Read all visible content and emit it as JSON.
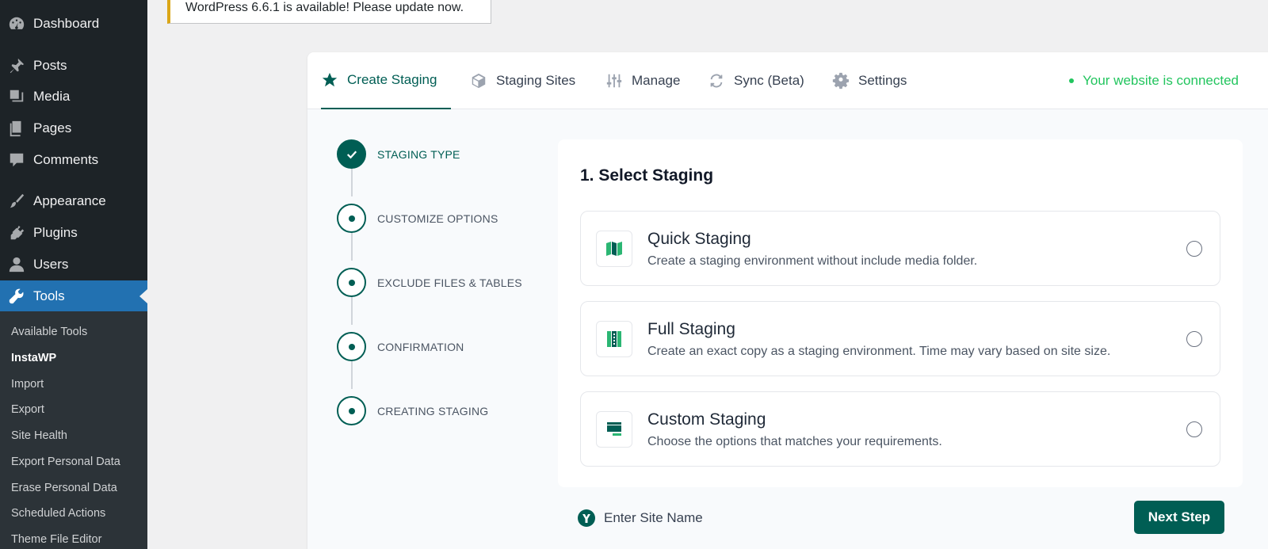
{
  "sidebar": {
    "items": [
      {
        "label": "Dashboard",
        "icon": "dashboard-icon"
      },
      {
        "label": "Posts",
        "icon": "pin-icon"
      },
      {
        "label": "Media",
        "icon": "media-icon"
      },
      {
        "label": "Pages",
        "icon": "pages-icon"
      },
      {
        "label": "Comments",
        "icon": "comment-icon"
      },
      {
        "label": "Appearance",
        "icon": "paintbrush-icon"
      },
      {
        "label": "Plugins",
        "icon": "plug-icon"
      },
      {
        "label": "Users",
        "icon": "user-icon"
      },
      {
        "label": "Tools",
        "icon": "wrench-icon",
        "active": true
      }
    ],
    "submenu": [
      "Available Tools",
      "InstaWP",
      "Import",
      "Export",
      "Site Health",
      "Export Personal Data",
      "Erase Personal Data",
      "Scheduled Actions",
      "Theme File Editor"
    ],
    "current_submenu": "InstaWP"
  },
  "notice": {
    "text": "WordPress 6.6.1 is available! Please update now.",
    "accent_color": "#dba617"
  },
  "tabs": [
    {
      "label": "Create Staging",
      "icon": "star-icon",
      "active": true
    },
    {
      "label": "Staging Sites",
      "icon": "cube-icon"
    },
    {
      "label": "Manage",
      "icon": "sliders-icon"
    },
    {
      "label": "Sync (Beta)",
      "icon": "sync-icon"
    },
    {
      "label": "Settings",
      "icon": "gear-icon"
    }
  ],
  "status": {
    "text": "Your website is connected",
    "color": "#22c55e"
  },
  "steps": [
    {
      "label": "STAGING TYPE",
      "state": "done"
    },
    {
      "label": "CUSTOMIZE OPTIONS",
      "state": "pending"
    },
    {
      "label": "EXCLUDE FILES & TABLES",
      "state": "pending"
    },
    {
      "label": "CONFIRMATION",
      "state": "pending"
    },
    {
      "label": "CREATING STAGING",
      "state": "pending"
    }
  ],
  "card": {
    "title": "1. Select Staging",
    "options": [
      {
        "title": "Quick Staging",
        "description": "Create a staging environment without include media folder.",
        "icon": "quick-staging-icon"
      },
      {
        "title": "Full Staging",
        "description": "Create an exact copy as a staging environment. Time may vary based on site size.",
        "icon": "full-staging-icon"
      },
      {
        "title": "Custom Staging",
        "description": "Choose the options that matches your requirements.",
        "icon": "custom-staging-icon"
      }
    ]
  },
  "footer": {
    "site_name_placeholder": "Enter Site Name",
    "site_name_icon": "instawp-logo-icon",
    "next_label": "Next Step"
  },
  "colors": {
    "brand": "#005e54",
    "wp_admin_bg": "#1d2327",
    "wp_active": "#2271b1"
  }
}
